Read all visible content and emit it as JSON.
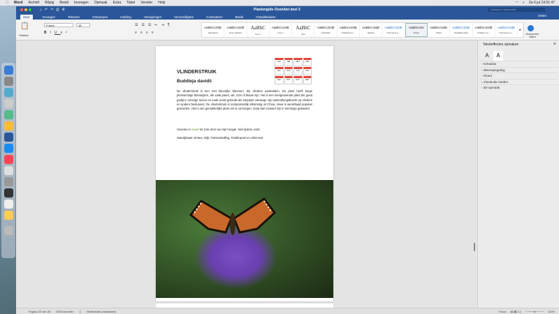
{
  "menubar": {
    "app": "Word",
    "items": [
      "Archief",
      "Wijzig",
      "Beeld",
      "Invoegen",
      "Opmaak",
      "Extra",
      "Tabel",
      "Venster",
      "Help"
    ],
    "clock": "Za 6 jul 19:51:47"
  },
  "window": {
    "title": "Plantengids Oostvliet deel 3",
    "search_placeholder": "Zoeken in document",
    "share": "Delen"
  },
  "tabs": [
    "Start",
    "Invoegen",
    "Tekenen",
    "Ontwerpen",
    "Indeling",
    "Verwijzingen",
    "Verzendlijsten",
    "Controleren",
    "Beeld",
    "Ontwikkelaars"
  ],
  "ribbon": {
    "paste": "Plakken",
    "font": "Futura",
    "size": "18",
    "styles_pane": "Deelvenster Stijlen",
    "styles": [
      {
        "preview": "AaBbCcDdE",
        "name": "Standaard"
      },
      {
        "preview": "AaBbCcDdE",
        "name": "Geen afstand"
      },
      {
        "preview": "AaBbC",
        "name": "Kop 1"
      },
      {
        "preview": "AaBbCcDdE",
        "name": "Kop 3"
      },
      {
        "preview": "AaBbC",
        "name": "Titel"
      },
      {
        "preview": "AaBbCcDdE",
        "name": "Ondertitel"
      },
      {
        "preview": "AaBbCcDdE",
        "name": "Subtiele ben..."
      },
      {
        "preview": "AaBbCcDdE",
        "name": "Nadruk"
      },
      {
        "preview": "AaBbCcDdE",
        "name": "Intensieve b..."
      },
      {
        "preview": "AaBbCcDc",
        "name": "Zwaar"
      },
      {
        "preview": "AaBbCcDdE",
        "name": "Citaat"
      },
      {
        "preview": "AaBbCcDdE",
        "name": "Duidelijk citaat"
      },
      {
        "preview": "AaBbCcDdE",
        "name": "Subtiele ver..."
      },
      {
        "preview": "AaBbCcDdE",
        "name": "Intensieve ve..."
      }
    ]
  },
  "document": {
    "heading": "VLINDERSTRUIK",
    "subheading": "Buddleja davidii",
    "body": "De vlinderstruik is een met kleurrijke bloemen, die vlinders aantrekken. De plant heeft lange pluimachtige bloeiwijzen, die vaak paars, wit, roze of blauw zijn. Het is een snelgroeiende plant die goed gedijt in zonnige tuinen en vaak wordt gebruikt als sierplant vanwege zijn aantrekkingskracht op vlinders en andere bestuivers. De vlinderstruik is oorspronkelijk afkomstig uit China, maar is wereldwijd populair geworden. Het is een gemakkelijke plant om te verzorgen, maar kan invasief zijn in sommige gebieden.",
    "prune_pre": "Snoeien in ",
    "prune_month": "maart",
    "prune_post": " tot 1/3e deel van zijn hoogte. Niet tijdens vorst.",
    "location": "Standplaats: Entree, Dijk, Fietsenstalling, Padderpoel en Uilennest",
    "months": [
      "JAN",
      "FEB",
      "MRT",
      "APR",
      "MEI",
      "JUNI",
      "JULI",
      "AUG",
      "SEP",
      "OKT",
      "NOV",
      "DEC"
    ]
  },
  "sidebar": {
    "title": "Teksteffecten opmaken",
    "tab1": "A",
    "tab2": "A",
    "sections": [
      "Schaduw",
      "Weerspiegeling",
      "Gloed",
      "Vloeiende randen",
      "3D-opmaak"
    ]
  },
  "status": {
    "page": "Pagina 22 van 28",
    "words": "2878 woorden",
    "language": "Nederlands (standaard)",
    "focus": "Focus",
    "zoom": "110%"
  },
  "colors": {
    "accent": "#2b579a",
    "month_header": "#e0453a",
    "highlight": "#5a9e2f"
  }
}
